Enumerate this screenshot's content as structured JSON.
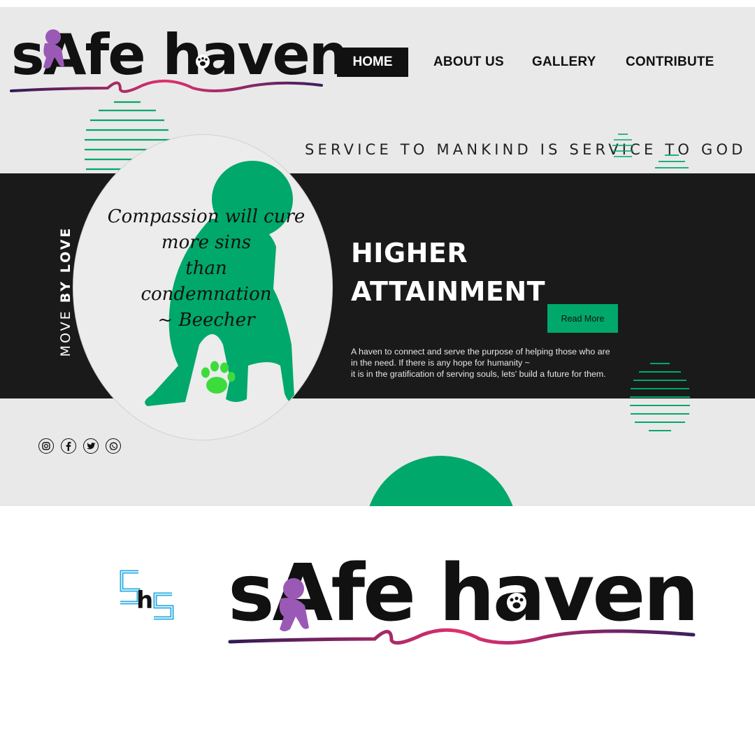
{
  "brand": {
    "name": "sAfe haven",
    "monogram": "ShS"
  },
  "nav": {
    "items": [
      {
        "label": "HOME",
        "active": true
      },
      {
        "label": "ABOUT US",
        "active": false
      },
      {
        "label": "GALLERY",
        "active": false
      },
      {
        "label": "CONTRIBUTE",
        "active": false
      }
    ]
  },
  "hero": {
    "tagline": "SERVICE TO MANKIND IS SERVICE TO GOD",
    "side_text_light": "MOVE",
    "side_text_bold": "BY LOVE",
    "quote_lines": [
      "Compassion will cure",
      "more sins",
      "than",
      "condemnation",
      "~ Beecher"
    ],
    "headline_line1": "HIGHER",
    "headline_line2": "ATTAINMENT",
    "cta_label": "Read More",
    "description_line1": "A haven to connect and serve the purpose of helping those who are",
    "description_line2": "in the need. If there is any hope for humanity ~",
    "description_line3": "it is in the gratification of serving souls, lets' build a future for them."
  },
  "social": [
    "instagram-icon",
    "facebook-icon",
    "twitter-icon",
    "whatsapp-icon"
  ],
  "colors": {
    "accent_green": "#00a86b",
    "band_black": "#1a1a1a",
    "hero_gray": "#e9e9e9",
    "baby_purple": "#9b59b6",
    "paw_green": "#3ddc3d",
    "monogram_blue": "#29abe2",
    "swash_start": "#3b1f5e",
    "swash_mid": "#e0306e"
  }
}
